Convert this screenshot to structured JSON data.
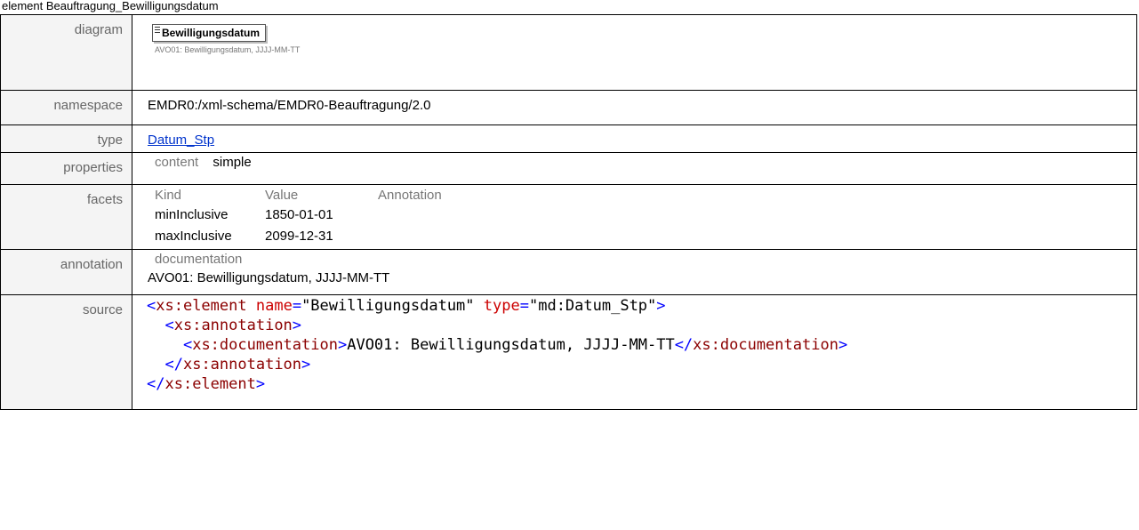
{
  "header": {
    "title": "element Beauftragung_Bewilligungsdatum"
  },
  "rows": {
    "diagram": {
      "label": "diagram",
      "element_name": "Bewilligungsdatum",
      "note": "AVO01: Bewilligungsdatum, JJJJ-MM-TT"
    },
    "namespace": {
      "label": "namespace",
      "value": "EMDR0:/xml-schema/EMDR0-Beauftragung/2.0"
    },
    "type": {
      "label": "type",
      "link": "Datum_Stp"
    },
    "properties": {
      "label": "properties",
      "key": "content",
      "value": "simple"
    },
    "facets": {
      "label": "facets",
      "headers": [
        "Kind",
        "Value",
        "Annotation"
      ],
      "items": [
        {
          "kind": "minInclusive",
          "value": "1850-01-01",
          "annotation": ""
        },
        {
          "kind": "maxInclusive",
          "value": "2099-12-31",
          "annotation": ""
        }
      ]
    },
    "annotation": {
      "label": "annotation",
      "key": "documentation",
      "value": "AVO01: Bewilligungsdatum, JJJJ-MM-TT"
    },
    "source": {
      "label": "source",
      "tag_element": "xs:element",
      "attr_name": "name",
      "attr_name_value": "\"Bewilligungsdatum\"",
      "attr_type": "type",
      "attr_type_value": "\"md:Datum_Stp\"",
      "tag_annotation": "xs:annotation",
      "tag_documentation": "xs:documentation",
      "doc_text": "AVO01: Bewilligungsdatum, JJJJ-MM-TT"
    }
  }
}
